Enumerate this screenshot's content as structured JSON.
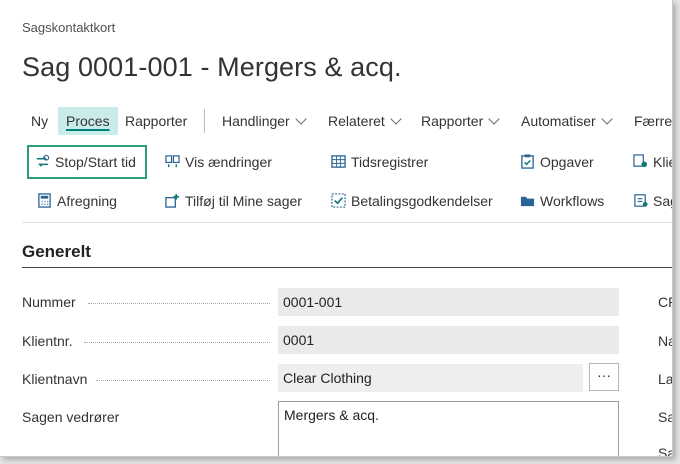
{
  "breadcrumb": "Sagskontaktkort",
  "title": "Sag 0001-001 - Mergers & acq.",
  "menu": {
    "ny": "Ny",
    "proces": "Proces",
    "rapporter": "Rapporter",
    "handlinger": "Handlinger",
    "relateret": "Relateret",
    "rapporter2": "Rapporter",
    "automatiser": "Automatiser",
    "faerre": "Færre"
  },
  "actions": {
    "stop_start": "Stop/Start tid",
    "vis_aendringer": "Vis ændringer",
    "tidsregistrer": "Tidsregistrer",
    "opgaver": "Opgaver",
    "klie": "Klie",
    "afregning": "Afregning",
    "tilfoej": "Tilføj til Mine sager",
    "betalingsgodkendelser": "Betalingsgodkendelser",
    "workflows": "Workflows",
    "sag": "Sag"
  },
  "section_title": "Generelt",
  "fields": {
    "nummer_label": "Nummer",
    "nummer_value": "0001-001",
    "klientnr_label": "Klientnr.",
    "klientnr_value": "0001",
    "klientnavn_label": "Klientnavn",
    "klientnavn_value": "Clear Clothing",
    "ellipsis": "···",
    "vedroerer_label": "Sagen vedrører",
    "vedroerer_value": "Mergers & acq."
  },
  "right_column": {
    "r1": "CP",
    "r2": "Na",
    "r3": "La",
    "r4": "Sa",
    "r5": "Sa"
  },
  "icons": [
    "swap-clock-icon",
    "view-changes-icon",
    "time-register-icon",
    "tasks-icon",
    "client-icon",
    "calculator-icon",
    "add-to-my-cases-icon",
    "payment-approval-icon",
    "workflow-icon",
    "case-icon"
  ],
  "colors": {
    "accent": "#00827a",
    "active_tab_bg": "#c9ebe9",
    "highlight_border": "#2e9e70",
    "icon_blue": "#2a6496",
    "icon_teal": "#117a73"
  }
}
